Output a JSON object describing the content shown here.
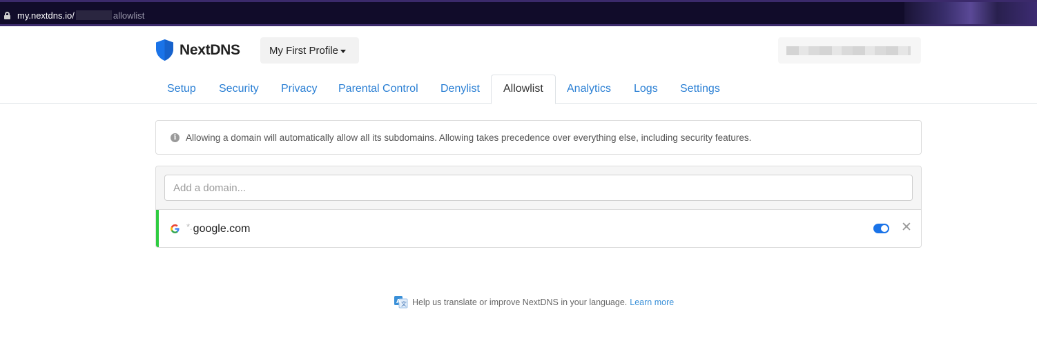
{
  "browser": {
    "url_host": "my.nextdns.io/",
    "url_path": "allowlist"
  },
  "header": {
    "brand": "NextDNS",
    "profile_label": "My First Profile"
  },
  "tabs": [
    {
      "label": "Setup"
    },
    {
      "label": "Security"
    },
    {
      "label": "Privacy"
    },
    {
      "label": "Parental Control"
    },
    {
      "label": "Denylist"
    },
    {
      "label": "Allowlist",
      "active": true
    },
    {
      "label": "Analytics"
    },
    {
      "label": "Logs"
    },
    {
      "label": "Settings"
    }
  ],
  "info": {
    "text": "Allowing a domain will automatically allow all its subdomains. Allowing takes precedence over everything else, including security features."
  },
  "allowlist": {
    "input_placeholder": "Add a domain...",
    "entries": [
      {
        "wildcard": "*.",
        "domain": "google.com",
        "enabled": true
      }
    ]
  },
  "footer": {
    "text": "Help us translate or improve NextDNS in your language.",
    "link": "Learn more"
  },
  "colors": {
    "accent": "#2a7fd4",
    "brand_shield": "#1a73e8",
    "entry_border": "#2ecc40",
    "toggle_on": "#1a73e8"
  }
}
